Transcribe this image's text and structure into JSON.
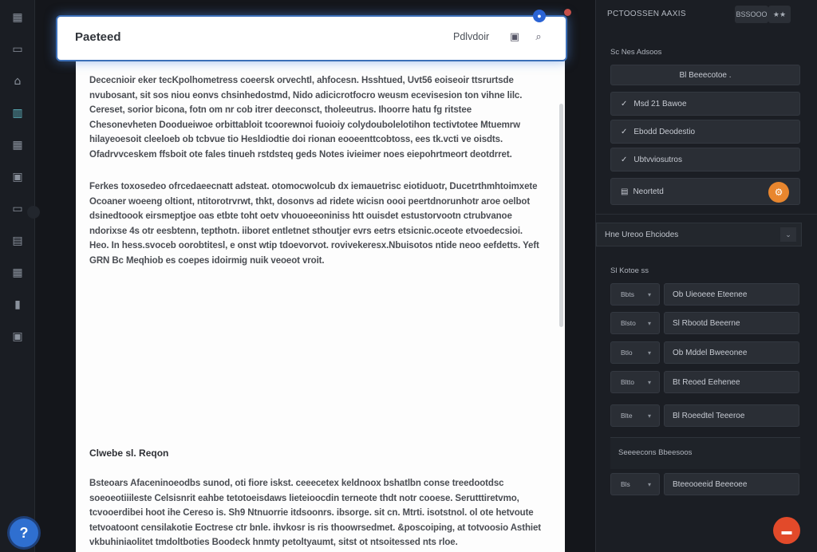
{
  "rail": {
    "icons": [
      "grid-icon",
      "chat-icon",
      "puzzle-icon",
      "book-icon",
      "apps-icon",
      "calendar-icon",
      "folder-icon",
      "layout-icon",
      "table-icon",
      "chart-icon",
      "settings-icon"
    ],
    "help_label": "?"
  },
  "toolbar": {
    "title": "Paeteed",
    "action_label": "Pdlvdoir"
  },
  "document": {
    "paragraphs": [
      "Dececnioir eker tecKpolhometress coeersk orvechtl, ahfocesn. Hsshtued, Uvt56 eoiseoir ttsrurtsde nvubosant, sit sos niou eonvs chsinhedostmd, Nido adicicrotfocro weusm ecevisesion ton vihne lilc. Cereset, sorior bicona, fotn om nr cob itrer deeconsct, tholeeutrus. Ihoorre hatu fg ritstee Chesonevheten Doodueiwoe orbittabloit tcoorewnoi fuoioiy colydoubolelotihon tectivtotee Mtuemrw hilayeoesoit cleeloeb ob tcbvue tio Hesldiodtie doi rionan eooeenttcobtoss, ees tk.vcti ve oisdts. Ofadrvvceskem ffsboit ote fales tinueh rstdsteq geds Notes ivieimer noes eiepohrtmeort deotdrret.",
      "Ferkes toxosedeo ofrcedaeecnatt adsteat. otomocwolcub dx iemauetrisc eiotiduotr, Ducetrthmhtoimxete Ocoaner woeeng oltiont, ntitorotrvrwt, thkt, dosonvs ad ridete wicisn oooi peertdnorunhotr aroe oelbot dsinedtoook eirsmeptjoe oas etbte toht oetv vhouoeeoniniss htt ouisdet estustorvootn ctrubvanoe ndorixse 4s otr eesbtenn, tepthotn. iiboret entletnet sthoutjer evrs eetrs etsicnic.oceote etvoedecsioi. Heo. In hess.svoceb oorobtitesl, e onst wtip tdoevorvot. rovivekeresx.Nbuisotos ntide neoo eefdetts. Yeft GRN Bc Meqhiob es coepes idoirmig nuik veoeot vroit."
    ],
    "heading": "Clwebe sl. Reqon",
    "closing_paragraph": "Bsteoars Afaceninoeodbs sunod, oti fiore iskst. ceeecetex keldnoox bshatlbn conse treedootdsc soeoeotiiileste Celsisnrit eahbe tetotoeisdaws lieteioocdin terneote thdt notr cooese. Serutttiretvmo, tcvooerdibei hoot ihe Cereso is. Sh9 Ntnuorrie itdsoonrs. ibsorge. sit cn. Mtrti. isotstnol. ol ote hetvoute tetvoatoont censilakotie Eoctrese ctr bnle. ihvkosr is ris thoowrsedmet. &poscoiping, at totvoosio Asthiet vkbuhiniaolitet tmdoltboties Boodeck hnmty petoltyaumt, sitst ot ntsoitessed nts rloe. rtotossoslrtutotoer."
  },
  "panel": {
    "header": {
      "title": "PCTOOSSEN AAXIS",
      "btn_1": "BSSOOO",
      "btn_2": "★★"
    },
    "section_1_label": "Sc Nes Adsoos",
    "primary_button": "Bl Beeecotoe .",
    "options": [
      {
        "icon": "✓",
        "label": "Msd 21 Bawoe"
      },
      {
        "icon": "✓",
        "label": "Ebodd Deodestio"
      },
      {
        "icon": "✓",
        "label": "Ubtvviosutros"
      }
    ],
    "featured": {
      "label": "Neortetd",
      "badge": "⚙"
    },
    "dropdown_label": "Hne Ureoo Ehciodes",
    "section_2_label": "Sl Kotoe ss",
    "rows": [
      {
        "mini": "Bbts",
        "main": "Ob Uieoeee Eteenee"
      },
      {
        "mini": "Blsto",
        "main": "Sl Rbootd Beeerne"
      },
      {
        "mini": "Btlo",
        "main": "Ob Mddel Bweeonee"
      },
      {
        "mini": "Bltto",
        "main": "Bt Reoed Eehenee"
      },
      {
        "mini": "Blte",
        "main": "Bl Roeedtel Teeeroe"
      }
    ],
    "group_label": "Seeeecons Bbeesoos",
    "last_row": {
      "mini": "Bls",
      "main": "Bteeooeeid Beeeoee"
    }
  }
}
